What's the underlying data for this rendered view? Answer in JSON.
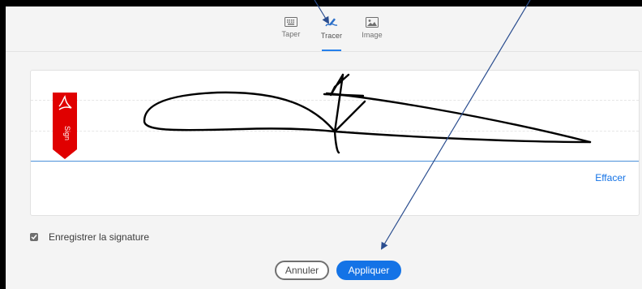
{
  "tabs": [
    {
      "label": "Taper",
      "icon": "keyboard-icon",
      "active": false
    },
    {
      "label": "Tracer",
      "icon": "draw-pen-icon",
      "active": true
    },
    {
      "label": "Image",
      "icon": "image-icon",
      "active": false
    }
  ],
  "signature_pad": {
    "clear_label": "Effacer",
    "badge_text": "Sign"
  },
  "options": {
    "save_signature_label": "Enregistrer la signature",
    "save_signature_checked": true
  },
  "actions": {
    "cancel_label": "Annuler",
    "apply_label": "Appliquer"
  },
  "colors": {
    "accent": "#1473e6",
    "badge_red": "#e00000",
    "annotation_arrow": "#2a4d8f"
  }
}
